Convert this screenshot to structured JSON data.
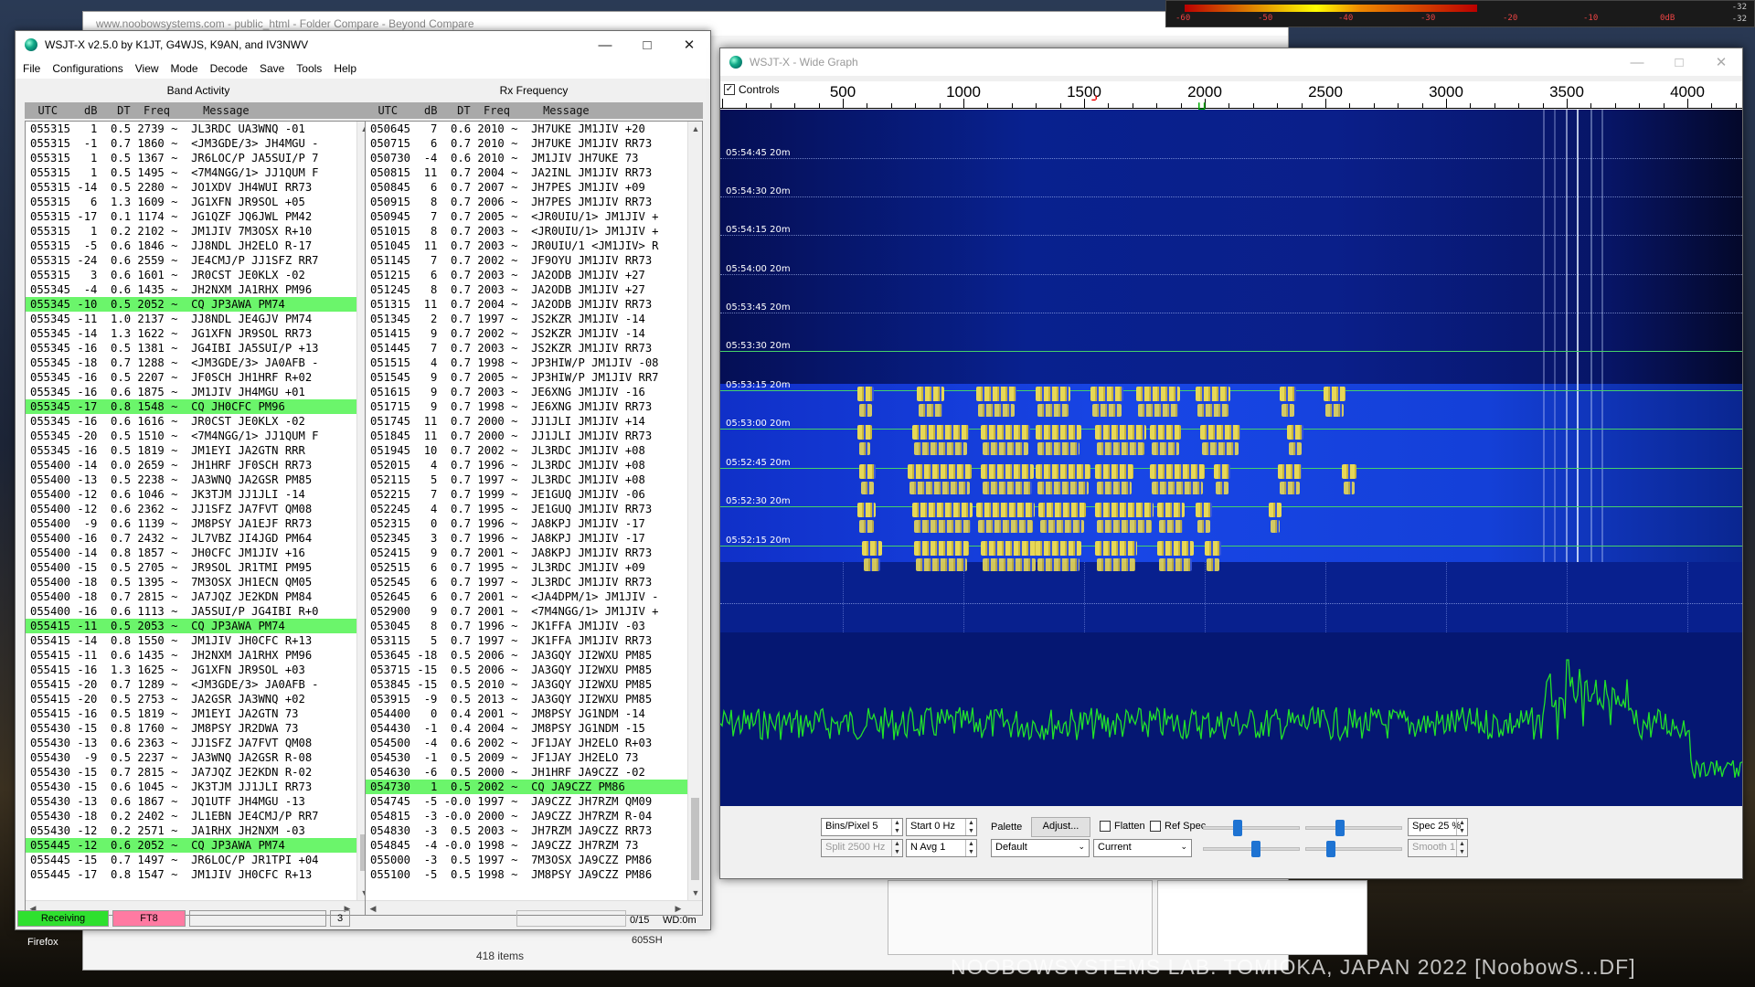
{
  "background": {
    "explorer_title": "www.noobowsystems.com - public_html - Folder Compare - Beyond Compare",
    "status_items": "418 items",
    "folder_item": "605SH",
    "desktop_label": "Firefox"
  },
  "meter": {
    "ticks": [
      "-60",
      "-50",
      "-40",
      "-30",
      "-20",
      "-10",
      "0dB"
    ],
    "right_top": "-32",
    "right_bottom": "-32"
  },
  "watermark": "NOOBOWSYSTEMS LAB. TOMIOKA, JAPAN 2022 [NoobowS...DF]",
  "wsjtx": {
    "title": "WSJT-X   v2.5.0   by K1JT, G4WJS, K9AN, and IV3NWV",
    "menu": [
      "File",
      "Configurations",
      "View",
      "Mode",
      "Decode",
      "Save",
      "Tools",
      "Help"
    ],
    "band_activity": {
      "header": "Band Activity",
      "columns": "  UTC    dB   DT  Freq     Message",
      "rows": [
        {
          "t": "055315   1  0.5 2739 ~  JL3RDC UA3WNQ -01",
          "cq": false
        },
        {
          "t": "055315  -1  0.7 1860 ~  <JM3GDE/3> JH4MGU -",
          "cq": false
        },
        {
          "t": "055315   1  0.5 1367 ~  JR6LOC/P JA5SUI/P 7",
          "cq": false
        },
        {
          "t": "055315   1  0.5 1495 ~  <7M4NGG/1> JJ1QUM F",
          "cq": false
        },
        {
          "t": "055315 -14  0.5 2280 ~  JO1XDV JH4WUI RR73",
          "cq": false
        },
        {
          "t": "055315   6  1.3 1609 ~  JG1XFN JR9SOL +05",
          "cq": false
        },
        {
          "t": "055315 -17  0.1 1174 ~  JG1QZF JQ6JWL PM42",
          "cq": false
        },
        {
          "t": "055315   1  0.2 2102 ~  JM1JIV 7M3OSX R+10",
          "cq": false
        },
        {
          "t": "055315  -5  0.6 1846 ~  JJ8NDL JH2ELO R-17",
          "cq": false
        },
        {
          "t": "055315 -24  0.6 2559 ~  JE4CMJ/P JJ1SFZ RR7",
          "cq": false
        },
        {
          "t": "055315   3  0.6 1601 ~  JR0CST JE0KLX -02",
          "cq": false
        },
        {
          "t": "055345  -4  0.6 1435 ~  JH2NXM JA1RHX PM96",
          "cq": false
        },
        {
          "t": "055345 -10  0.5 2052 ~  CQ JP3AWA PM74",
          "cq": true
        },
        {
          "t": "055345 -11  1.0 2137 ~  JJ8NDL JE4GJV PM74",
          "cq": false
        },
        {
          "t": "055345 -14  1.3 1622 ~  JG1XFN JR9SOL RR73",
          "cq": false
        },
        {
          "t": "055345 -16  0.5 1381 ~  JG4IBI JA5SUI/P +13",
          "cq": false
        },
        {
          "t": "055345 -18  0.7 1288 ~  <JM3GDE/3> JA0AFB -",
          "cq": false
        },
        {
          "t": "055345 -16  0.5 2207 ~  JF0SCH JH1HRF R+02",
          "cq": false
        },
        {
          "t": "055345 -16  0.6 1875 ~  JM1JIV JH4MGU +01",
          "cq": false
        },
        {
          "t": "055345 -17  0.8 1548 ~  CQ JH0CFC PM96",
          "cq": true
        },
        {
          "t": "055345 -16  0.6 1616 ~  JR0CST JE0KLX -02",
          "cq": false
        },
        {
          "t": "055345 -20  0.5 1510 ~  <7M4NGG/1> JJ1QUM F",
          "cq": false
        },
        {
          "t": "055345 -16  0.5 1819 ~  JM1EYI JA2GTN RRR",
          "cq": false
        },
        {
          "t": "055400 -14  0.0 2659 ~  JH1HRF JF0SCH RR73",
          "cq": false
        },
        {
          "t": "055400 -13  0.5 2238 ~  JA3WNQ JA2GSR PM85",
          "cq": false
        },
        {
          "t": "055400 -12  0.6 1046 ~  JK3TJM JJ1JLI -14",
          "cq": false
        },
        {
          "t": "055400 -12  0.6 2362 ~  JJ1SFZ JA7FVT QM08",
          "cq": false
        },
        {
          "t": "055400  -9  0.6 1139 ~  JM8PSY JA1EJF RR73",
          "cq": false
        },
        {
          "t": "055400 -16  0.7 2432 ~  JL7VBZ JI4JGD PM64",
          "cq": false
        },
        {
          "t": "055400 -14  0.8 1857 ~  JH0CFC JM1JIV +16",
          "cq": false
        },
        {
          "t": "055400 -15  0.5 2705 ~  JR9SOL JR1TMI PM95",
          "cq": false
        },
        {
          "t": "055400 -18  0.5 1395 ~  7M3OSX JH1ECN QM05",
          "cq": false
        },
        {
          "t": "055400 -18  0.7 2815 ~  JA7JQZ JE2KDN PM84",
          "cq": false
        },
        {
          "t": "055400 -16  0.6 1113 ~  JA5SUI/P JG4IBI R+0",
          "cq": false
        },
        {
          "t": "055415 -11  0.5 2053 ~  CQ JP3AWA PM74",
          "cq": true
        },
        {
          "t": "055415 -14  0.8 1550 ~  JM1JIV JH0CFC R+13",
          "cq": false
        },
        {
          "t": "055415 -11  0.6 1435 ~  JH2NXM JA1RHX PM96",
          "cq": false
        },
        {
          "t": "055415 -16  1.3 1625 ~  JG1XFN JR9SOL +03",
          "cq": false
        },
        {
          "t": "055415 -20  0.7 1289 ~  <JM3GDE/3> JA0AFB -",
          "cq": false
        },
        {
          "t": "055415 -20  0.5 2753 ~  JA2GSR JA3WNQ +02",
          "cq": false
        },
        {
          "t": "055415 -16  0.5 1819 ~  JM1EYI JA2GTN 73",
          "cq": false
        },
        {
          "t": "055430 -15  0.8 1760 ~  JM8PSY JR2DWA 73",
          "cq": false
        },
        {
          "t": "055430 -13  0.6 2363 ~  JJ1SFZ JA7FVT QM08",
          "cq": false
        },
        {
          "t": "055430  -9  0.5 2237 ~  JA3WNQ JA2GSR R-08",
          "cq": false
        },
        {
          "t": "055430 -15  0.7 2815 ~  JA7JQZ JE2KDN R-02",
          "cq": false
        },
        {
          "t": "055430 -15  0.6 1045 ~  JK3TJM JJ1JLI RR73",
          "cq": false
        },
        {
          "t": "055430 -13  0.6 1867 ~  JQ1UTF JH4MGU -13",
          "cq": false
        },
        {
          "t": "055430 -18  0.2 2402 ~  JL1EBN JE4CMJ/P RR7",
          "cq": false
        },
        {
          "t": "055430 -12  0.2 2571 ~  JA1RHX JH2NXM -03",
          "cq": false
        },
        {
          "t": "055445 -12  0.6 2052 ~  CQ JP3AWA PM74",
          "cq": true
        },
        {
          "t": "055445 -15  0.7 1497 ~  JR6LOC/P JR1TPI +04",
          "cq": false
        },
        {
          "t": "055445 -17  0.8 1547 ~  JM1JIV JH0CFC R+13",
          "cq": false
        }
      ]
    },
    "rx_frequency": {
      "header": "Rx Frequency",
      "columns": "  UTC    dB   DT  Freq     Message",
      "rows": [
        {
          "t": "050645   7  0.6 2010 ~  JH7UKE JM1JIV +20",
          "cq": false
        },
        {
          "t": "050715   6  0.7 2010 ~  JH7UKE JM1JIV RR73",
          "cq": false
        },
        {
          "t": "050730  -4  0.6 2010 ~  JM1JIV JH7UKE 73",
          "cq": false
        },
        {
          "t": "050815  11  0.7 2004 ~  JA2INL JM1JIV RR73",
          "cq": false
        },
        {
          "t": "050845   6  0.7 2007 ~  JH7PES JM1JIV +09",
          "cq": false
        },
        {
          "t": "050915   8  0.7 2006 ~  JH7PES JM1JIV RR73",
          "cq": false
        },
        {
          "t": "050945   7  0.7 2005 ~  <JR0UIU/1> JM1JIV +",
          "cq": false
        },
        {
          "t": "051015   8  0.7 2003 ~  <JR0UIU/1> JM1JIV +",
          "cq": false
        },
        {
          "t": "051045  11  0.7 2003 ~  JR0UIU/1 <JM1JIV> R",
          "cq": false
        },
        {
          "t": "051145   7  0.7 2002 ~  JF9OYU JM1JIV RR73",
          "cq": false
        },
        {
          "t": "051215   6  0.7 2003 ~  JA2ODB JM1JIV +27",
          "cq": false
        },
        {
          "t": "051245   8  0.7 2003 ~  JA2ODB JM1JIV +27",
          "cq": false
        },
        {
          "t": "051315  11  0.7 2004 ~  JA2ODB JM1JIV RR73",
          "cq": false
        },
        {
          "t": "051345   2  0.7 1997 ~  JS2KZR JM1JIV -14",
          "cq": false
        },
        {
          "t": "051415   9  0.7 2002 ~  JS2KZR JM1JIV -14",
          "cq": false
        },
        {
          "t": "051445   7  0.7 2003 ~  JS2KZR JM1JIV RR73",
          "cq": false
        },
        {
          "t": "051515   4  0.7 1998 ~  JP3HIW/P JM1JIV -08",
          "cq": false
        },
        {
          "t": "051545   9  0.7 2005 ~  JP3HIW/P JM1JIV RR7",
          "cq": false
        },
        {
          "t": "051615   9  0.7 2003 ~  JE6XNG JM1JIV -16",
          "cq": false
        },
        {
          "t": "051715   9  0.7 1998 ~  JE6XNG JM1JIV RR73",
          "cq": false
        },
        {
          "t": "051745  11  0.7 2000 ~  JJ1JLI JM1JIV +14",
          "cq": false
        },
        {
          "t": "051845  11  0.7 2000 ~  JJ1JLI JM1JIV RR73",
          "cq": false
        },
        {
          "t": "051945  10  0.7 2002 ~  JL3RDC JM1JIV +08",
          "cq": false
        },
        {
          "t": "052015   4  0.7 1996 ~  JL3RDC JM1JIV +08",
          "cq": false
        },
        {
          "t": "052115   5  0.7 1997 ~  JL3RDC JM1JIV +08",
          "cq": false
        },
        {
          "t": "052215   7  0.7 1999 ~  JE1GUQ JM1JIV -06",
          "cq": false
        },
        {
          "t": "052245   4  0.7 1995 ~  JE1GUQ JM1JIV RR73",
          "cq": false
        },
        {
          "t": "052315   0  0.7 1996 ~  JA8KPJ JM1JIV -17",
          "cq": false
        },
        {
          "t": "052345   3  0.7 1996 ~  JA8KPJ JM1JIV -17",
          "cq": false
        },
        {
          "t": "052415   9  0.7 2001 ~  JA8KPJ JM1JIV RR73",
          "cq": false
        },
        {
          "t": "052515   6  0.7 1995 ~  JL3RDC JM1JIV +09",
          "cq": false
        },
        {
          "t": "052545   6  0.7 1997 ~  JL3RDC JM1JIV RR73",
          "cq": false
        },
        {
          "t": "052645   6  0.7 2001 ~  <JA4DPM/1> JM1JIV -",
          "cq": false
        },
        {
          "t": "052900   9  0.7 2001 ~  <7M4NGG/1> JM1JIV +",
          "cq": false
        },
        {
          "t": "053045   8  0.7 1996 ~  JK1FFA JM1JIV -03",
          "cq": false
        },
        {
          "t": "053115   5  0.7 1997 ~  JK1FFA JM1JIV RR73",
          "cq": false
        },
        {
          "t": "053645 -18  0.5 2006 ~  JA3GQY JI2WXU PM85",
          "cq": false
        },
        {
          "t": "053715 -15  0.5 2006 ~  JA3GQY JI2WXU PM85",
          "cq": false
        },
        {
          "t": "053845 -15  0.5 2010 ~  JA3GQY JI2WXU PM85",
          "cq": false
        },
        {
          "t": "053915  -9  0.5 2013 ~  JA3GQY JI2WXU PM85",
          "cq": false
        },
        {
          "t": "054400   0  0.4 2001 ~  JM8PSY JG1NDM -14",
          "cq": false
        },
        {
          "t": "054430  -1  0.4 2004 ~  JM8PSY JG1NDM -15",
          "cq": false
        },
        {
          "t": "054500  -4  0.6 2002 ~  JF1JAY JH2ELO R+03",
          "cq": false
        },
        {
          "t": "054530  -1  0.5 2009 ~  JF1JAY JH2ELO 73",
          "cq": false
        },
        {
          "t": "054630  -6  0.5 2000 ~  JH1HRF JA9CZZ -02",
          "cq": false
        },
        {
          "t": "054730   1  0.5 2002 ~  CQ JA9CZZ PM86",
          "cq": true
        },
        {
          "t": "054745  -5 -0.0 1997 ~  JA9CZZ JH7RZM QM09",
          "cq": false
        },
        {
          "t": "054815  -3 -0.0 2000 ~  JA9CZZ JH7RZM R-04",
          "cq": false
        },
        {
          "t": "054830  -3  0.5 2003 ~  JH7RZM JA9CZZ RR73",
          "cq": false
        },
        {
          "t": "054845  -4 -0.0 1998 ~  JA9CZZ JH7RZM 73",
          "cq": false
        },
        {
          "t": "055000  -3  0.5 1997 ~  7M3OSX JA9CZZ PM86",
          "cq": false
        },
        {
          "t": "055100  -5  0.5 1998 ~  JM8PSY JA9CZZ PM86",
          "cq": false
        }
      ]
    },
    "status": {
      "receiving": "Receiving",
      "mode": "FT8",
      "count": "3",
      "decodes": "0/15",
      "wd": "WD:0m"
    }
  },
  "widegraph": {
    "title": "WSJT-X - Wide Graph",
    "controls_label": "Controls",
    "freq_labels": [
      "500",
      "1000",
      "1500",
      "2000",
      "2500",
      "3000",
      "3500",
      "4000"
    ],
    "timestamps": [
      {
        "time": "05:54:45",
        "band": "20m"
      },
      {
        "time": "05:54:30",
        "band": "20m"
      },
      {
        "time": "05:54:15",
        "band": "20m"
      },
      {
        "time": "05:54:00",
        "band": "20m"
      },
      {
        "time": "05:53:45",
        "band": "20m"
      },
      {
        "time": "05:53:30",
        "band": "20m"
      },
      {
        "time": "05:53:15",
        "band": "20m"
      },
      {
        "time": "05:53:00",
        "band": "20m"
      },
      {
        "time": "05:52:45",
        "band": "20m"
      },
      {
        "time": "05:52:30",
        "band": "20m"
      },
      {
        "time": "05:52:15",
        "band": "20m"
      }
    ],
    "controls": {
      "bins_per_pixel": "Bins/Pixel  5",
      "start": "Start 0 Hz",
      "palette_label": "Palette",
      "adjust": "Adjust...",
      "flatten": "Flatten",
      "ref_spec": "Ref Spec",
      "spec": "Spec 25 %",
      "split": "Split  2500  Hz",
      "navg": "N Avg  1",
      "palette": "Default",
      "spectrum": "Current",
      "smooth": "Smooth  1"
    }
  }
}
